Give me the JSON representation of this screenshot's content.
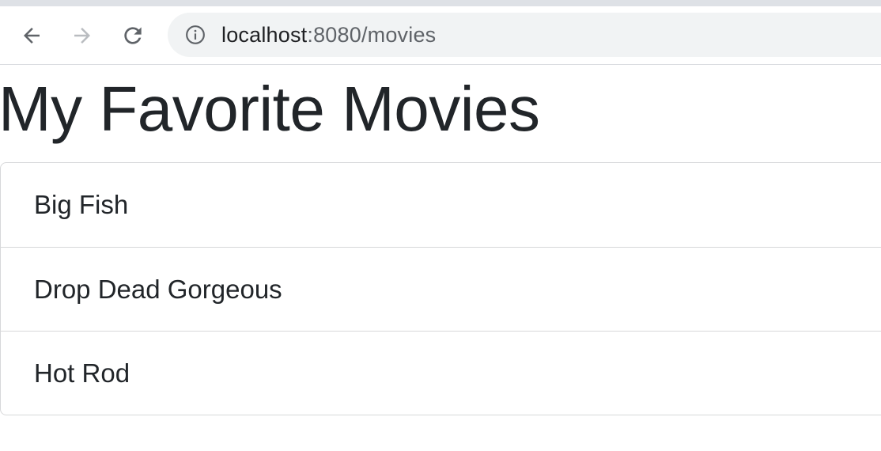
{
  "browser": {
    "url_host": "localhost",
    "url_rest": ":8080/movies",
    "icons": {
      "back": "back-arrow-icon",
      "forward": "forward-arrow-icon",
      "reload": "reload-icon",
      "site_info": "info-icon"
    }
  },
  "page": {
    "title": "My Favorite Movies",
    "movies": [
      {
        "title": "Big Fish"
      },
      {
        "title": "Drop Dead Gorgeous"
      },
      {
        "title": "Hot Rod"
      }
    ]
  },
  "colors": {
    "text": "#212529",
    "border": "#d7d8da",
    "omnibox_bg": "#f1f3f4"
  }
}
